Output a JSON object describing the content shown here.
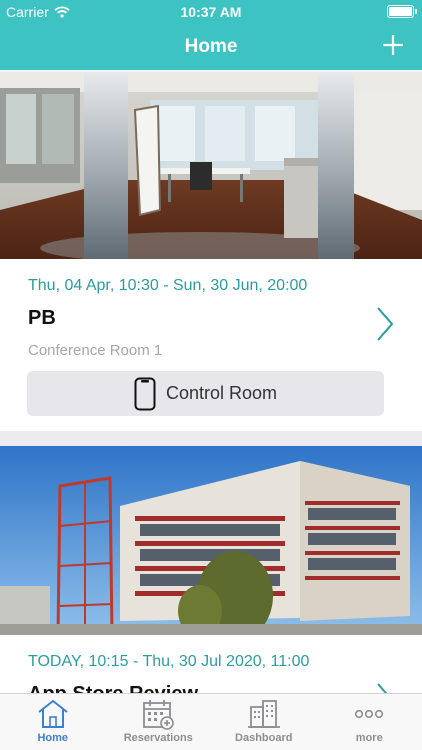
{
  "status_bar": {
    "carrier": "Carrier",
    "time": "10:37 AM"
  },
  "nav": {
    "title": "Home",
    "add_icon": "plus-icon"
  },
  "colors": {
    "accent": "#3ec3c3",
    "date_text": "#2a9da0",
    "tab_active": "#3e7fd6"
  },
  "reservations": [
    {
      "date_range": "Thu, 04 Apr, 10:30 - Sun, 30 Jun, 20:00",
      "title": "PB",
      "location": "Conference Room 1",
      "action_label": "Control Room",
      "action_icon": "phone-icon",
      "photo": "conference-room-photo"
    },
    {
      "date_range": "TODAY, 10:15 - Thu, 30 Jul 2020, 11:00",
      "title": "App Store Review",
      "photo": "office-building-photo"
    }
  ],
  "tabs": [
    {
      "label": "Home",
      "icon": "house-icon",
      "active": true
    },
    {
      "label": "Reservations",
      "icon": "calendar-icon",
      "active": false
    },
    {
      "label": "Dashboard",
      "icon": "buildings-icon",
      "active": false
    },
    {
      "label": "more",
      "icon": "ellipsis-icon",
      "active": false
    }
  ]
}
